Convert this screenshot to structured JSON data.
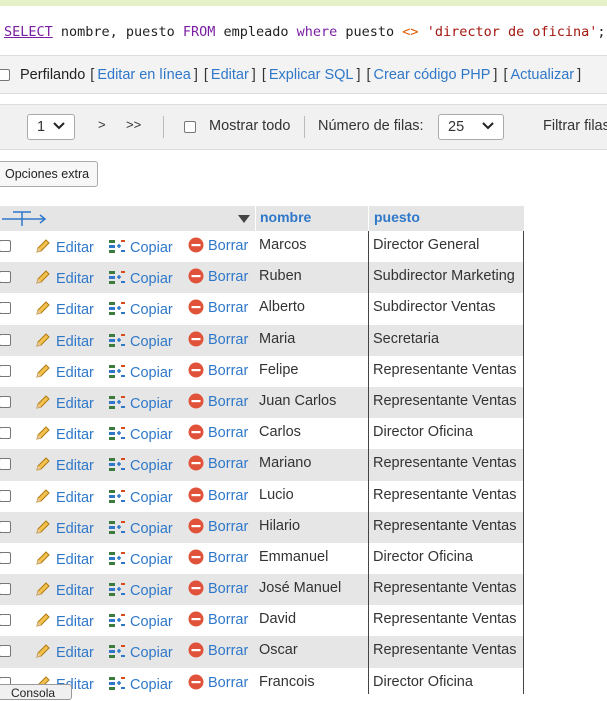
{
  "sql": {
    "kw_select": "SELECT",
    "part1": " nombre, puesto ",
    "kw_from": "FROM",
    "part2": " empleado ",
    "kw_where": "where",
    "part3": " puesto ",
    "op": "<>",
    "space": " ",
    "literal": "'director de oficina'",
    "end": ";"
  },
  "profiling": {
    "label": "Perfilando",
    "links": [
      "Editar en línea",
      "Editar",
      "Explicar SQL",
      "Crear código PHP",
      "Actualizar"
    ]
  },
  "nav": {
    "page_value": "1",
    "next": ">",
    "last": ">>",
    "show_all_label": "Mostrar todo",
    "rows_label": "Número de filas:",
    "rows_value": "25",
    "filter_label": "Filtrar filas"
  },
  "extra_options": "Opciones extra",
  "table": {
    "columns": [
      "nombre",
      "puesto"
    ],
    "actions": {
      "edit": "Editar",
      "copy": "Copiar",
      "delete": "Borrar"
    },
    "rows": [
      {
        "nombre": "Marcos",
        "puesto": "Director General"
      },
      {
        "nombre": "Ruben",
        "puesto": "Subdirector Marketing"
      },
      {
        "nombre": "Alberto",
        "puesto": "Subdirector Ventas"
      },
      {
        "nombre": "Maria",
        "puesto": "Secretaria"
      },
      {
        "nombre": "Felipe",
        "puesto": "Representante Ventas"
      },
      {
        "nombre": "Juan Carlos",
        "puesto": "Representante Ventas"
      },
      {
        "nombre": "Carlos",
        "puesto": "Director Oficina"
      },
      {
        "nombre": "Mariano",
        "puesto": "Representante Ventas"
      },
      {
        "nombre": "Lucio",
        "puesto": "Representante Ventas"
      },
      {
        "nombre": "Hilario",
        "puesto": "Representante Ventas"
      },
      {
        "nombre": "Emmanuel",
        "puesto": "Director Oficina"
      },
      {
        "nombre": "José Manuel",
        "puesto": "Representante Ventas"
      },
      {
        "nombre": "David",
        "puesto": "Representante Ventas"
      },
      {
        "nombre": "Oscar",
        "puesto": "Representante Ventas"
      },
      {
        "nombre": "Francois",
        "puesto": "Director Oficina"
      }
    ]
  },
  "console_label": "Consola",
  "colors": {
    "link": "#2f78c9",
    "row_alt": "#e6e6e6",
    "keyword": "#7a1fa2",
    "string": "#a3170f"
  }
}
